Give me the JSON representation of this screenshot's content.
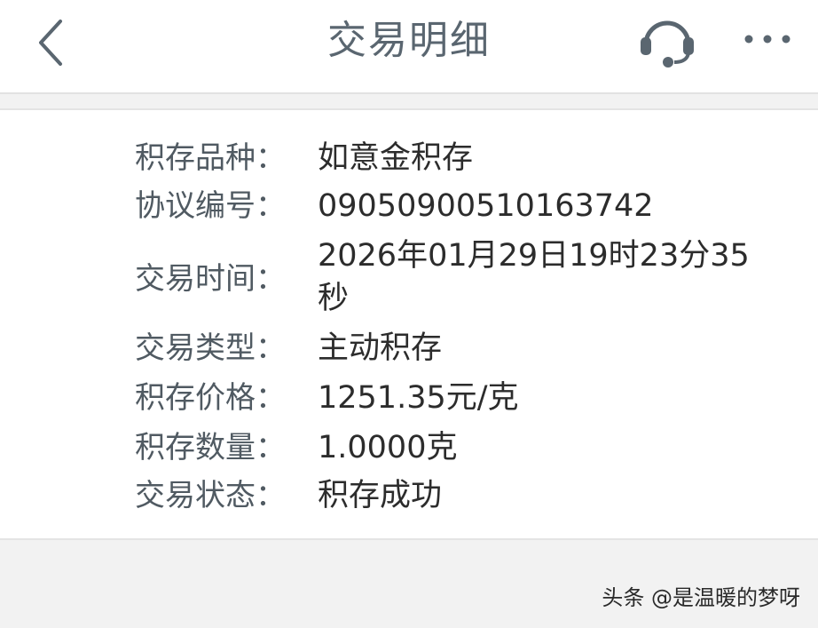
{
  "header": {
    "title": "交易明细",
    "back_icon": "chevron-left-icon",
    "service_icon": "headset-icon",
    "more_icon": "more-dots-icon"
  },
  "details": [
    {
      "label": "积存品种：",
      "value": "如意金积存"
    },
    {
      "label": "协议编号：",
      "value": "0905090051016374​2"
    },
    {
      "label": "交易时间：",
      "value": "2026年01月29日19时23分35秒"
    },
    {
      "label": "交易类型：",
      "value": "主动积存"
    },
    {
      "label": "积存价格：",
      "value": "1251.35元/克"
    },
    {
      "label": "积存数量：",
      "value": "1.0000克"
    },
    {
      "label": "交易状态：",
      "value": "积存成功"
    }
  ],
  "watermark": "头条 @是温暖的梦呀",
  "colors": {
    "title": "#5a6670",
    "label": "#505a62",
    "value": "#2c2c2c",
    "background": "#f2f2f2"
  }
}
